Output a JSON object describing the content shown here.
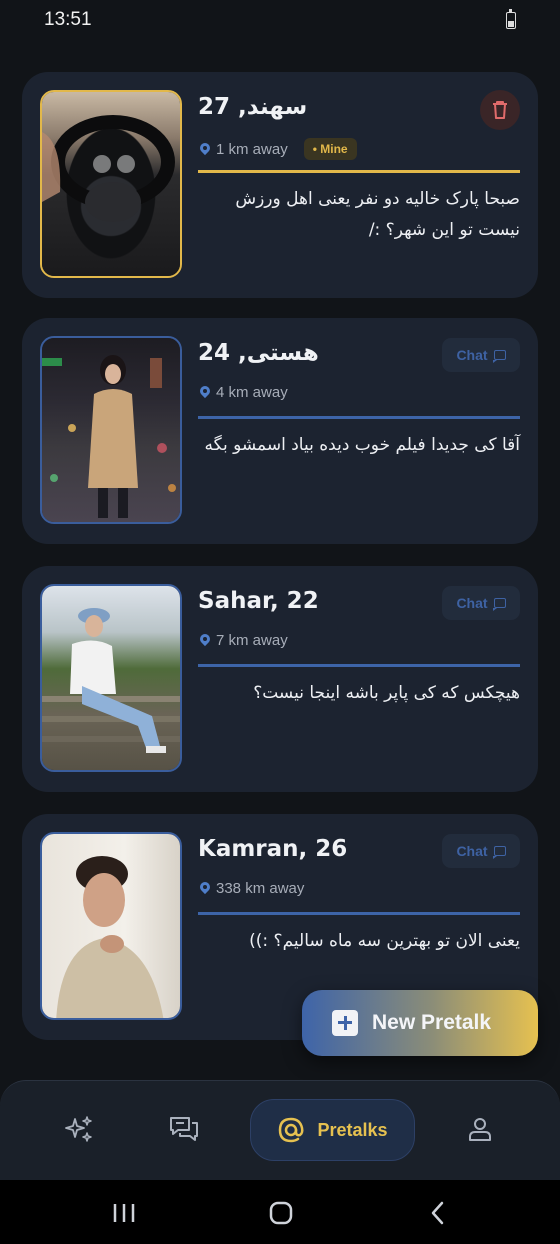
{
  "status_bar": {
    "time": "13:51"
  },
  "cards": [
    {
      "name": "سهند, 27",
      "distance": "1 km away",
      "badge": "Mine",
      "message": "صبحا پارک خالیه دو نفر یعنی اهل ورزش نیست تو این شهر؟ :/",
      "action": "delete",
      "accent_color": "#e2b84a"
    },
    {
      "name": "هستی, 24",
      "distance": "4 km away",
      "message": "آقا کی جدیدا فیلم خوب دیده بیاد اسمشو بگه",
      "action_label": "Chat",
      "accent_color": "#3d64a8"
    },
    {
      "name": "Sahar, 22",
      "distance": "7 km away",
      "message": "هیچکس که کی پاپر باشه اینجا نیست؟",
      "action_label": "Chat",
      "accent_color": "#3d64a8"
    },
    {
      "name": "Kamran, 26",
      "distance": "338 km away",
      "message": "یعنی الان تو بهترین سه ماه سالیم؟ :))",
      "action_label": "Chat",
      "accent_color": "#3d64a8"
    }
  ],
  "fab": {
    "label": "New Pretalk",
    "icon": "plus-message-icon"
  },
  "bottom_nav": {
    "items": [
      {
        "icon": "sparkles-icon"
      },
      {
        "icon": "chats-icon"
      },
      {
        "icon": "at-sign-icon",
        "label": "Pretalks",
        "active": true
      },
      {
        "icon": "person-icon"
      }
    ]
  },
  "colors": {
    "background": "#111418",
    "card": "#1c2330",
    "accent_blue": "#3d64a8",
    "accent_gold": "#e2b84a"
  }
}
